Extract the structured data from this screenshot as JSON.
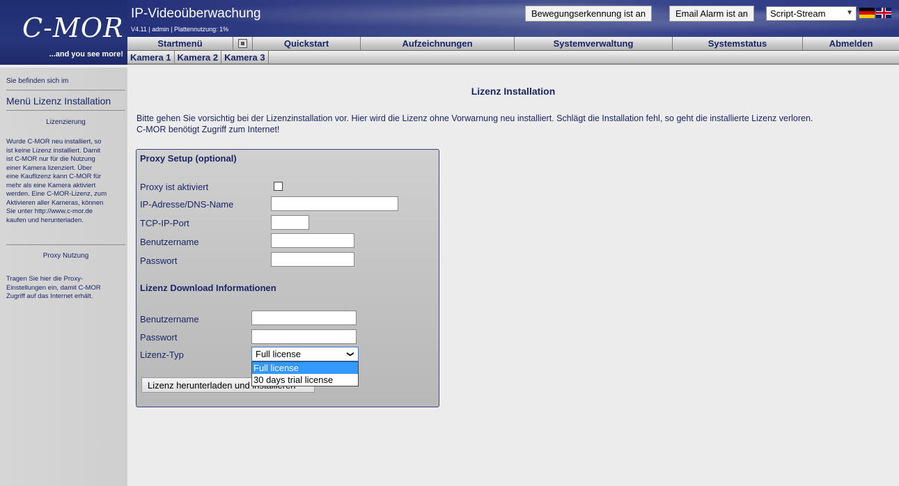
{
  "logo": {
    "text": "C-MOR",
    "slogan": "...and you see more!"
  },
  "header": {
    "title": "IP-Videoüberwachung",
    "meta": "V4.11 | admin | Plattennutzung: 1%",
    "motion_button": "Bewegungserkennung ist an",
    "email_button": "Email Alarm ist an",
    "stream_select": "Script-Stream"
  },
  "mainnav": {
    "items": [
      "Startmenü",
      "Quickstart",
      "Aufzeichnungen",
      "Systemverwaltung",
      "Systemstatus",
      "Abmelden"
    ]
  },
  "camnav": {
    "items": [
      "Kamera 1",
      "Kamera 2",
      "Kamera 3"
    ]
  },
  "sidebar": {
    "where": "Sie befinden sich im",
    "menu": "Menü Lizenz Installation",
    "section1_title": "Lizenzierung",
    "section1_lines": [
      "Wurde C-MOR neu installiert, so",
      "ist keine Lizenz installiert. Damit",
      "ist C-MOR nur für die Nutzung",
      "einer Kamera lizenziert. Über",
      "eine Kauflizenz kann C-MOR für",
      "mehr als eine Kamera aktiviert",
      "werden. Eine C-MOR-Lizenz, zum",
      "Aktivieren aller Kameras, können",
      "Sie unter http://www.c-mor.de",
      "kaufen und herunterladen."
    ],
    "section2_title": "Proxy Nutzung",
    "section2_lines": [
      "Tragen Sie hier die Proxy-",
      "Einstellungen ein, damit C-MOR",
      "Zugriff auf das Internet erhält."
    ]
  },
  "main": {
    "title": "Lizenz Installation",
    "intro_line1": "Bitte gehen Sie vorsichtig bei der Lizenzinstallation vor. Hier wird die Lizenz ohne Vorwarnung neu installiert. Schlägt die Installation fehl, so geht die installierte Lizenz verloren.",
    "intro_line2": "C-MOR benötigt Zugriff zum Internet!"
  },
  "proxy": {
    "title": "Proxy Setup (optional)",
    "enabled_label": "Proxy ist aktiviert",
    "enabled": false,
    "host_label": "IP-Adresse/DNS-Name",
    "host_value": "",
    "port_label": "TCP-IP-Port",
    "port_value": "",
    "user_label": "Benutzername",
    "user_value": "",
    "pass_label": "Passwort",
    "pass_value": ""
  },
  "license": {
    "title": "Lizenz Download Informationen",
    "user_label": "Benutzername",
    "user_value": "",
    "pass_label": "Passwort",
    "pass_value": "",
    "type_label": "Lizenz-Typ",
    "type_selected": "Full license",
    "type_options": [
      "Full license",
      "30 days trial license"
    ],
    "button": "Lizenz herunterladen und installieren"
  }
}
